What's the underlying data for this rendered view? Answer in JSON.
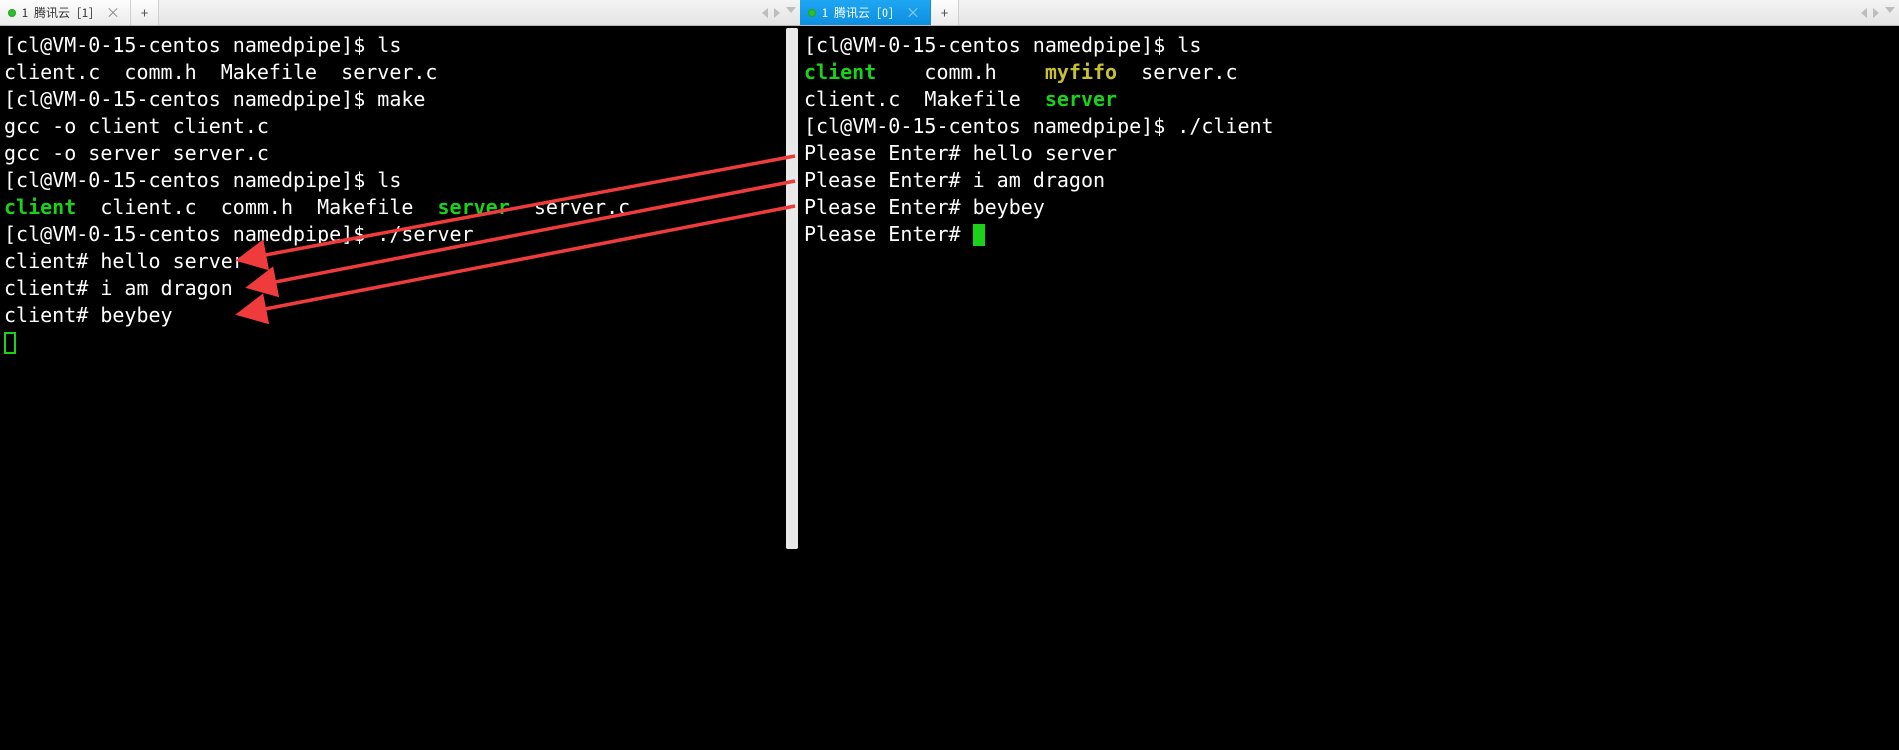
{
  "left": {
    "tab": {
      "title": "1 腾讯云 [1]"
    },
    "lines": [
      [
        {
          "t": "[cl@VM-0-15-centos namedpipe]$ ls"
        }
      ],
      [
        {
          "t": "client.c  comm.h  Makefile  server.c"
        }
      ],
      [
        {
          "t": "[cl@VM-0-15-centos namedpipe]$ make"
        }
      ],
      [
        {
          "t": "gcc -o client client.c"
        }
      ],
      [
        {
          "t": "gcc -o server server.c"
        }
      ],
      [
        {
          "t": "[cl@VM-0-15-centos namedpipe]$ ls"
        }
      ],
      [
        {
          "t": "client",
          "c": "green"
        },
        {
          "t": "  client.c  comm.h  Makefile  "
        },
        {
          "t": "server",
          "c": "green"
        },
        {
          "t": "  server.c"
        }
      ],
      [
        {
          "t": "[cl@VM-0-15-centos namedpipe]$ ./server"
        }
      ],
      [
        {
          "t": "client# hello server"
        }
      ],
      [
        {
          "t": "client# i am dragon"
        }
      ],
      [
        {
          "t": "client# beybey"
        }
      ]
    ],
    "cursor": "outline"
  },
  "right": {
    "tab": {
      "title": "1 腾讯云 [0]"
    },
    "lines": [
      [
        {
          "t": "[cl@VM-0-15-centos namedpipe]$ ls"
        }
      ],
      [
        {
          "t": "client",
          "c": "green"
        },
        {
          "t": "    comm.h    "
        },
        {
          "t": "myfifo",
          "c": "yellow"
        },
        {
          "t": "  server.c"
        }
      ],
      [
        {
          "t": "client.c  Makefile  "
        },
        {
          "t": "server",
          "c": "green"
        }
      ],
      [
        {
          "t": "[cl@VM-0-15-centos namedpipe]$ ./client"
        }
      ],
      [
        {
          "t": "Please Enter# hello server"
        }
      ],
      [
        {
          "t": "Please Enter# i am dragon"
        }
      ],
      [
        {
          "t": "Please Enter# beybey"
        }
      ],
      [
        {
          "t": "Please Enter# "
        }
      ]
    ],
    "cursor": "block",
    "cursorInline": true
  },
  "glyphs": {
    "close": "×",
    "plus": "+"
  }
}
